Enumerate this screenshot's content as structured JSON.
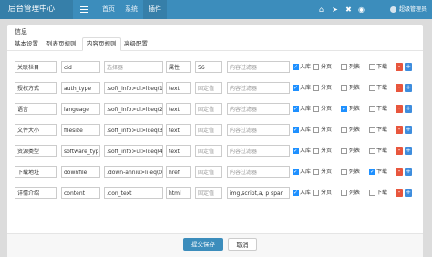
{
  "topbar": {
    "brand": "后台管理中心",
    "nav": [
      "首页",
      "系统",
      "插件"
    ],
    "user": "超级管理员"
  },
  "modal": {
    "title": "信息",
    "tabs": [
      "基本设置",
      "列表页规则",
      "内容页规则",
      "高级配置"
    ],
    "active_tab": 2,
    "rows": [
      {
        "label": "关联栏目",
        "field": "cid",
        "rule": "选择器",
        "rule_placeholder": true,
        "type": "属性",
        "value": "56",
        "value_placeholder": false,
        "filter": "内容过滤器",
        "filter_placeholder": true,
        "ruku": true,
        "fenye": false,
        "liebiao": false,
        "xiazai": false
      },
      {
        "label": "授权方式",
        "field": "auth_type",
        "rule": ".soft_info>ul>li:eq(1)>",
        "rule_placeholder": false,
        "type": "text",
        "value": "固定值",
        "value_placeholder": true,
        "filter": "内容过滤器",
        "filter_placeholder": true,
        "ruku": true,
        "fenye": false,
        "liebiao": false,
        "xiazai": false
      },
      {
        "label": "语言",
        "field": "language",
        "rule": ".soft_info>ul>li:eq(2)>",
        "rule_placeholder": false,
        "type": "text",
        "value": "固定值",
        "value_placeholder": true,
        "filter": "内容过滤器",
        "filter_placeholder": true,
        "ruku": true,
        "fenye": false,
        "liebiao": true,
        "xiazai": false
      },
      {
        "label": "文件大小",
        "field": "filesize",
        "rule": ".soft_info>ul>li:eq(3)>",
        "rule_placeholder": false,
        "type": "text",
        "value": "固定值",
        "value_placeholder": true,
        "filter": "内容过滤器",
        "filter_placeholder": true,
        "ruku": true,
        "fenye": false,
        "liebiao": false,
        "xiazai": false
      },
      {
        "label": "资源类型",
        "field": "software_typ",
        "rule": ".soft_info>ul>li:eq(4)>",
        "rule_placeholder": false,
        "type": "text",
        "value": "固定值",
        "value_placeholder": true,
        "filter": "内容过滤器",
        "filter_placeholder": true,
        "ruku": true,
        "fenye": false,
        "liebiao": false,
        "xiazai": false
      },
      {
        "label": "下载地址",
        "field": "downfile",
        "rule": ".down-anniu>li:eq(0)>",
        "rule_placeholder": false,
        "type": "href",
        "value": "固定值",
        "value_placeholder": true,
        "filter": "内容过滤器",
        "filter_placeholder": true,
        "ruku": true,
        "fenye": false,
        "liebiao": false,
        "xiazai": true
      },
      {
        "label": "详情介绍",
        "field": "content",
        "rule": ".con_text",
        "rule_placeholder": false,
        "type": "html",
        "value": "固定值",
        "value_placeholder": true,
        "filter": "img,script,a, p span",
        "filter_placeholder": false,
        "ruku": true,
        "fenye": false,
        "liebiao": false,
        "xiazai": false
      }
    ],
    "checkbox_labels": {
      "ruku": "入库",
      "fenye": "分页",
      "liebiao": "列表",
      "xiazai": "下载"
    },
    "btn_minus": "-",
    "btn_plus": "+",
    "save_label": "提交保存",
    "cancel_label": "取消"
  },
  "colors": {
    "topbar": "#3c8dbc",
    "checked": "#1e90ff",
    "minus": "#e8563d",
    "plus": "#3e8ddd"
  }
}
